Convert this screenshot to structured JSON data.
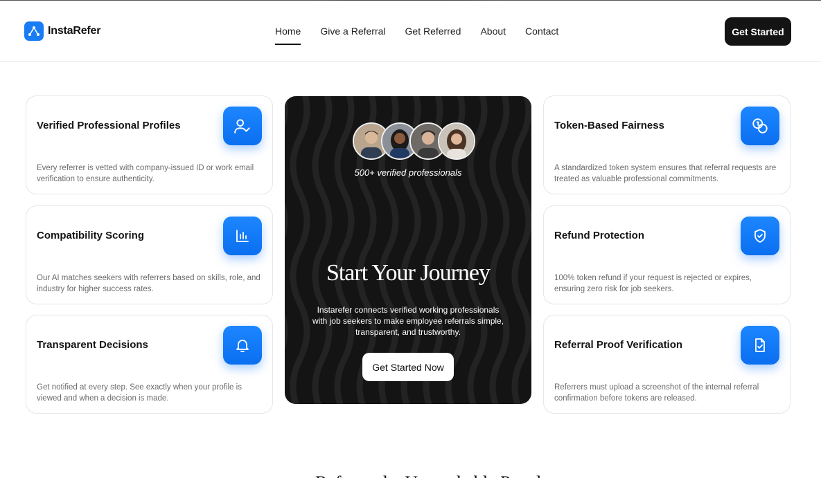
{
  "brand": {
    "name": "InstaRefer"
  },
  "nav": {
    "items": [
      {
        "label": "Home",
        "active": true
      },
      {
        "label": "Give a Referral"
      },
      {
        "label": "Get Referred"
      },
      {
        "label": "About"
      },
      {
        "label": "Contact"
      }
    ],
    "cta": "Get Started"
  },
  "features_left": [
    {
      "title": "Verified Professional Profiles",
      "desc": "Every referrer is vetted with company-issued ID or work email verification to ensure authenticity.",
      "icon": "user-check-icon"
    },
    {
      "title": "Compatibility Scoring",
      "desc": "Our AI matches seekers with referrers based on skills, role, and industry for higher success rates.",
      "icon": "bar-chart-icon"
    },
    {
      "title": "Transparent Decisions",
      "desc": "Get notified at every step. See exactly when your profile is viewed and when a decision is made.",
      "icon": "bell-icon"
    }
  ],
  "features_right": [
    {
      "title": "Token-Based Fairness",
      "desc": "A standardized token system ensures that referral requests are treated as valuable professional commitments.",
      "icon": "coins-icon"
    },
    {
      "title": "Refund Protection",
      "desc": "100% token refund if your request is rejected or expires, ensuring zero risk for job seekers.",
      "icon": "shield-check-icon"
    },
    {
      "title": "Referral Proof Verification",
      "desc": "Referrers must upload a screenshot of the internal referral confirmation before tokens are released.",
      "icon": "file-check-icon"
    }
  ],
  "hero": {
    "caption": "500+ verified professionals",
    "title": "Start Your Journey",
    "text": "Instarefer connects verified working professionals with job seekers to make employee referrals simple, transparent, and trustworthy.",
    "button": "Get Started Now"
  },
  "next_section": {
    "heading": "Refer to the Unreachable People"
  },
  "colors": {
    "accent": "#1a7cf5",
    "dark": "#141414"
  }
}
